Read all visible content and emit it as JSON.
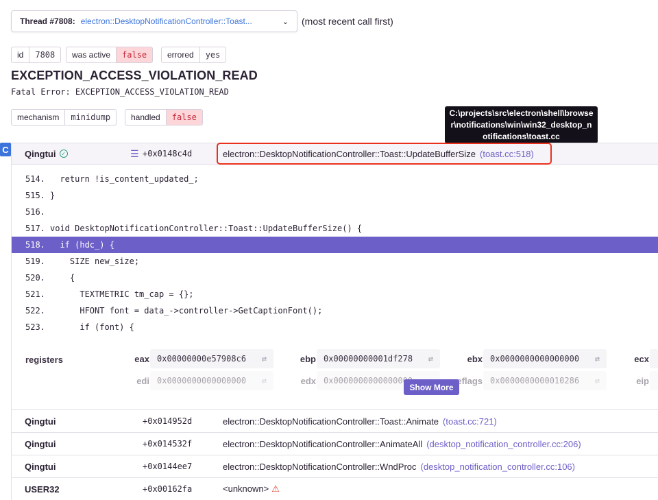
{
  "thread": {
    "label": "Thread #7808:",
    "value": "electron::DesktopNotificationController::Toast...",
    "note": "(most recent call first)"
  },
  "tags1": [
    {
      "key": "id",
      "value": "7808",
      "bad": false
    },
    {
      "key": "was active",
      "value": "false",
      "bad": true
    },
    {
      "key": "errored",
      "value": "yes",
      "bad": false
    }
  ],
  "exception": {
    "title": "EXCEPTION_ACCESS_VIOLATION_READ",
    "subtitle": "Fatal Error: EXCEPTION_ACCESS_VIOLATION_READ"
  },
  "tags2": [
    {
      "key": "mechanism",
      "value": "minidump",
      "bad": false
    },
    {
      "key": "handled",
      "value": "false",
      "bad": true
    }
  ],
  "tooltip": "C:\\projects\\src\\electron\\shell\\browser\\notifications\\win\\win32_desktop_notifications\\toast.cc",
  "first_frame": {
    "package": "Qingtui",
    "address": "+0x0148c4d",
    "function": "electron::DesktopNotificationController::Toast::UpdateBufferSize",
    "file": "(toast.cc:518)"
  },
  "code": [
    {
      "ln": "514.",
      "src": "  return !is_content_updated_;"
    },
    {
      "ln": "515.",
      "src": "}"
    },
    {
      "ln": "516.",
      "src": ""
    },
    {
      "ln": "517.",
      "src": "void DesktopNotificationController::Toast::UpdateBufferSize() {"
    },
    {
      "ln": "518.",
      "src": "  if (hdc_) {"
    },
    {
      "ln": "519.",
      "src": "    SIZE new_size;"
    },
    {
      "ln": "520.",
      "src": "    {"
    },
    {
      "ln": "521.",
      "src": "      TEXTMETRIC tm_cap = {};"
    },
    {
      "ln": "522.",
      "src": "      HFONT font = data_->controller->GetCaptionFont();"
    },
    {
      "ln": "523.",
      "src": "      if (font) {"
    }
  ],
  "registers": {
    "label": "registers",
    "row1": [
      {
        "name": "eax",
        "value": "0x00000000e57908c6"
      },
      {
        "name": "ebp",
        "value": "0x00000000001df278"
      },
      {
        "name": "ebx",
        "value": "0x0000000000000000"
      },
      {
        "name": "ecx",
        "value": ""
      }
    ],
    "row2": [
      {
        "name": "edi",
        "value": "0x0000000000000000"
      },
      {
        "name": "edx",
        "value": "0x0000000000000000"
      },
      {
        "name": "eflags",
        "value": "0x0000000000010286"
      },
      {
        "name": "eip",
        "value": ""
      }
    ],
    "show_more": "Show More"
  },
  "frames": [
    {
      "package": "Qingtui",
      "address": "+0x014952d",
      "function": "electron::DesktopNotificationController::Toast::Animate",
      "file": "(toast.cc:721)",
      "warn": false
    },
    {
      "package": "Qingtui",
      "address": "+0x014532f",
      "function": "electron::DesktopNotificationController::AnimateAll",
      "file": "(desktop_notification_controller.cc:206)",
      "warn": false
    },
    {
      "package": "Qingtui",
      "address": "+0x0144ee7",
      "function": "electron::DesktopNotificationController::WndProc",
      "file": "(desktop_notification_controller.cc:106)",
      "warn": false
    },
    {
      "package": "USER32",
      "address": "+0x00162fa",
      "function": "<unknown>",
      "file": "",
      "warn": true
    }
  ],
  "icons": {
    "check": "check-circle-icon",
    "menu": "lines-icon",
    "swap": "swap-icon",
    "warn": "warning-icon",
    "chevron": "chevron-down-icon",
    "platform": "c-platform-icon"
  }
}
